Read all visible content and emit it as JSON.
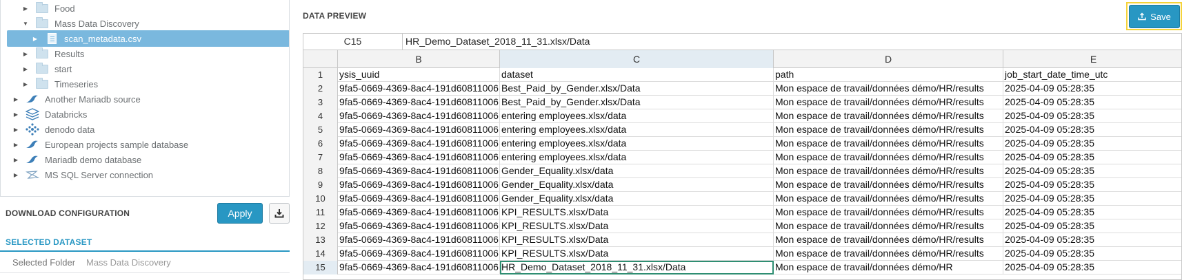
{
  "tree": {
    "items": [
      {
        "label": "Food",
        "icon": "folder-icon",
        "expanded": false
      },
      {
        "label": "Mass Data Discovery",
        "icon": "folder-icon",
        "expanded": true
      },
      {
        "label": "scan_metadata.csv",
        "icon": "file-icon",
        "expanded": false,
        "selected": true
      },
      {
        "label": "Results",
        "icon": "folder-icon",
        "expanded": false
      },
      {
        "label": "start",
        "icon": "folder-icon",
        "expanded": false
      },
      {
        "label": "Timeseries",
        "icon": "folder-icon",
        "expanded": false
      },
      {
        "label": "Another Mariadb source",
        "icon": "mariadb-icon",
        "expanded": false
      },
      {
        "label": "Databricks",
        "icon": "databricks-icon",
        "expanded": false
      },
      {
        "label": "denodo data",
        "icon": "denodo-icon",
        "expanded": false
      },
      {
        "label": "European projects sample database",
        "icon": "mariadb-icon",
        "expanded": false
      },
      {
        "label": "Mariadb demo database",
        "icon": "mariadb-icon",
        "expanded": false
      },
      {
        "label": "MS SQL Server connection",
        "icon": "sqlserver-icon",
        "expanded": false
      }
    ]
  },
  "download_config": {
    "title": "DOWNLOAD CONFIGURATION",
    "apply_label": "Apply",
    "download_icon": "download-icon"
  },
  "selected_dataset": {
    "title": "SELECTED DATASET",
    "folder_label": "Selected Folder",
    "folder_value": "Mass Data Discovery"
  },
  "preview": {
    "title": "DATA PREVIEW",
    "save_label": "Save",
    "save_icon": "upload-icon"
  },
  "sheet": {
    "cell_ref": "C15",
    "formula_value": "HR_Demo_Dataset_2018_11_31.xlsx/Data",
    "columns": [
      "B",
      "C",
      "D",
      "E"
    ],
    "active_column": "C",
    "active_row": "15",
    "rows": [
      {
        "n": "1",
        "b": "ysis_uuid",
        "c": "dataset",
        "d": "path",
        "e": "job_start_date_time_utc"
      },
      {
        "n": "2",
        "b": "9fa5-0669-4369-8ac4-191d60811006",
        "c": "Best_Paid_by_Gender.xlsx/Data",
        "d": "Mon espace de travail/données démo/HR/results",
        "e": "2025-04-09 05:28:35"
      },
      {
        "n": "3",
        "b": "9fa5-0669-4369-8ac4-191d60811006",
        "c": "Best_Paid_by_Gender.xlsx/Data",
        "d": "Mon espace de travail/données démo/HR/results",
        "e": "2025-04-09 05:28:35"
      },
      {
        "n": "4",
        "b": "9fa5-0669-4369-8ac4-191d60811006",
        "c": "entering employees.xlsx/data",
        "d": "Mon espace de travail/données démo/HR/results",
        "e": "2025-04-09 05:28:35"
      },
      {
        "n": "5",
        "b": "9fa5-0669-4369-8ac4-191d60811006",
        "c": "entering employees.xlsx/data",
        "d": "Mon espace de travail/données démo/HR/results",
        "e": "2025-04-09 05:28:35"
      },
      {
        "n": "6",
        "b": "9fa5-0669-4369-8ac4-191d60811006",
        "c": "entering employees.xlsx/data",
        "d": "Mon espace de travail/données démo/HR/results",
        "e": "2025-04-09 05:28:35"
      },
      {
        "n": "7",
        "b": "9fa5-0669-4369-8ac4-191d60811006",
        "c": "entering employees.xlsx/data",
        "d": "Mon espace de travail/données démo/HR/results",
        "e": "2025-04-09 05:28:35"
      },
      {
        "n": "8",
        "b": "9fa5-0669-4369-8ac4-191d60811006",
        "c": "Gender_Equality.xlsx/data",
        "d": "Mon espace de travail/données démo/HR/results",
        "e": "2025-04-09 05:28:35"
      },
      {
        "n": "9",
        "b": "9fa5-0669-4369-8ac4-191d60811006",
        "c": "Gender_Equality.xlsx/data",
        "d": "Mon espace de travail/données démo/HR/results",
        "e": "2025-04-09 05:28:35"
      },
      {
        "n": "10",
        "b": "9fa5-0669-4369-8ac4-191d60811006",
        "c": "Gender_Equality.xlsx/data",
        "d": "Mon espace de travail/données démo/HR/results",
        "e": "2025-04-09 05:28:35"
      },
      {
        "n": "11",
        "b": "9fa5-0669-4369-8ac4-191d60811006",
        "c": "KPI_RESULTS.xlsx/Data",
        "d": "Mon espace de travail/données démo/HR/results",
        "e": "2025-04-09 05:28:35"
      },
      {
        "n": "12",
        "b": "9fa5-0669-4369-8ac4-191d60811006",
        "c": "KPI_RESULTS.xlsx/Data",
        "d": "Mon espace de travail/données démo/HR/results",
        "e": "2025-04-09 05:28:35"
      },
      {
        "n": "13",
        "b": "9fa5-0669-4369-8ac4-191d60811006",
        "c": "KPI_RESULTS.xlsx/Data",
        "d": "Mon espace de travail/données démo/HR/results",
        "e": "2025-04-09 05:28:35"
      },
      {
        "n": "14",
        "b": "9fa5-0669-4369-8ac4-191d60811006",
        "c": "KPI_RESULTS.xlsx/Data",
        "d": "Mon espace de travail/données démo/HR/results",
        "e": "2025-04-09 05:28:35"
      },
      {
        "n": "15",
        "b": "9fa5-0669-4369-8ac4-191d60811006",
        "c": "HR_Demo_Dataset_2018_11_31.xlsx/Data",
        "d": "Mon espace de travail/données démo/HR",
        "e": "2025-04-09 05:28:35"
      }
    ]
  },
  "colors": {
    "accent": "#2897c3",
    "selected_row": "#7ab8de",
    "highlight": "#f5d33a"
  }
}
